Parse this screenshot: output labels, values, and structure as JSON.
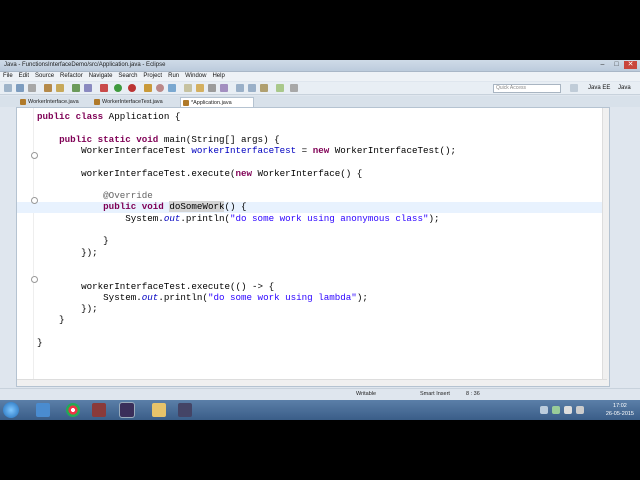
{
  "window": {
    "title": "Java - FunctionsInterfaceDemo/src/Application.java - Eclipse",
    "controls": [
      "–",
      "□",
      "✕"
    ]
  },
  "menu": [
    "File",
    "Edit",
    "Source",
    "Refactor",
    "Navigate",
    "Search",
    "Project",
    "Run",
    "Window",
    "Help"
  ],
  "toolbar": {
    "quick_access_placeholder": "Quick Access",
    "perspective": "Java EE",
    "perspective2": "Java"
  },
  "tabs": [
    {
      "label": "WorkerInterface.java",
      "active": false
    },
    {
      "label": "WorkerInterfaceTest.java",
      "active": false
    },
    {
      "label": "*Application.java",
      "active": true
    }
  ],
  "code_lines": [
    [
      {
        "t": "public class",
        "c": "kw"
      },
      {
        "t": " Application {"
      }
    ],
    [],
    [
      {
        "t": "    "
      },
      {
        "t": "public static void",
        "c": "kw"
      },
      {
        "t": " main(String[] args) {"
      }
    ],
    [
      {
        "t": "        WorkerInterfaceTest "
      },
      {
        "t": "workerInterfaceTest",
        "c": "fld"
      },
      {
        "t": " = "
      },
      {
        "t": "new",
        "c": "kw"
      },
      {
        "t": " WorkerInterfaceTest();"
      }
    ],
    [],
    [
      {
        "t": "        workerInterfaceTest.execute("
      },
      {
        "t": "new",
        "c": "kw"
      },
      {
        "t": " WorkerInterface() {"
      }
    ],
    [],
    [
      {
        "t": "            "
      },
      {
        "t": "@Override",
        "c": "ann"
      }
    ],
    [
      {
        "t": "            "
      },
      {
        "t": "public void",
        "c": "kw"
      },
      {
        "t": " "
      },
      {
        "t": "doSomeWork",
        "c": "hl"
      },
      {
        "t": "() {"
      }
    ],
    [
      {
        "t": "                System."
      },
      {
        "t": "out",
        "c": "stat"
      },
      {
        "t": ".println("
      },
      {
        "t": "\"do some work using anonymous class\"",
        "c": "str"
      },
      {
        "t": ");"
      }
    ],
    [],
    [
      {
        "t": "            }"
      }
    ],
    [
      {
        "t": "        });"
      }
    ],
    [],
    [],
    [
      {
        "t": "        workerInterfaceTest.execute(() -> {"
      }
    ],
    [
      {
        "t": "            System."
      },
      {
        "t": "out",
        "c": "stat"
      },
      {
        "t": ".println("
      },
      {
        "t": "\"do some work using lambda\"",
        "c": "str"
      },
      {
        "t": ");"
      }
    ],
    [
      {
        "t": "        });"
      }
    ],
    [
      {
        "t": "    }"
      }
    ],
    [],
    [
      {
        "t": "}"
      }
    ]
  ],
  "status": {
    "writable": "Writable",
    "insert_mode": "Smart Insert",
    "position": "8 : 36"
  },
  "clock": {
    "time": "17:02",
    "date": "26-05-2015"
  }
}
